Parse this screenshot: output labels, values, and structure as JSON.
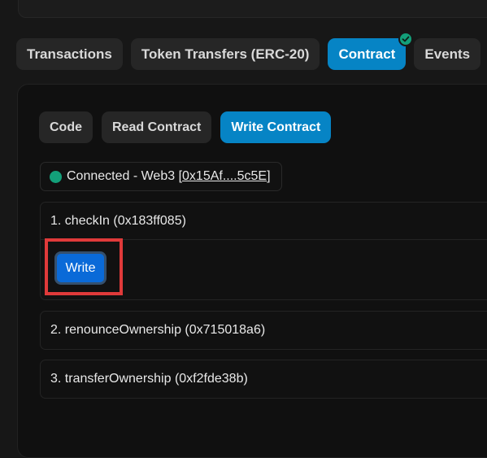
{
  "tabs": [
    {
      "label": "Transactions"
    },
    {
      "label": "Token Transfers (ERC-20)"
    },
    {
      "label": "Contract",
      "active": true,
      "verified": true
    },
    {
      "label": "Events"
    }
  ],
  "subtabs": [
    {
      "label": "Code"
    },
    {
      "label": "Read Contract"
    },
    {
      "label": "Write Contract",
      "active": true
    }
  ],
  "connection": {
    "status_text": "Connected - Web3 [",
    "address": "0x15Af....5c5E",
    "close_bracket": "]"
  },
  "functions": [
    {
      "label": "1. checkIn (0x183ff085)",
      "button": "Write"
    },
    {
      "label": "2. renounceOwnership (0x715018a6)"
    },
    {
      "label": "3. transferOwnership (0xf2fde38b)"
    }
  ],
  "colors": {
    "accent": "#0684c5",
    "success": "#13a07a",
    "highlight": "#e03a3a",
    "write_button": "#0a6ad8"
  }
}
